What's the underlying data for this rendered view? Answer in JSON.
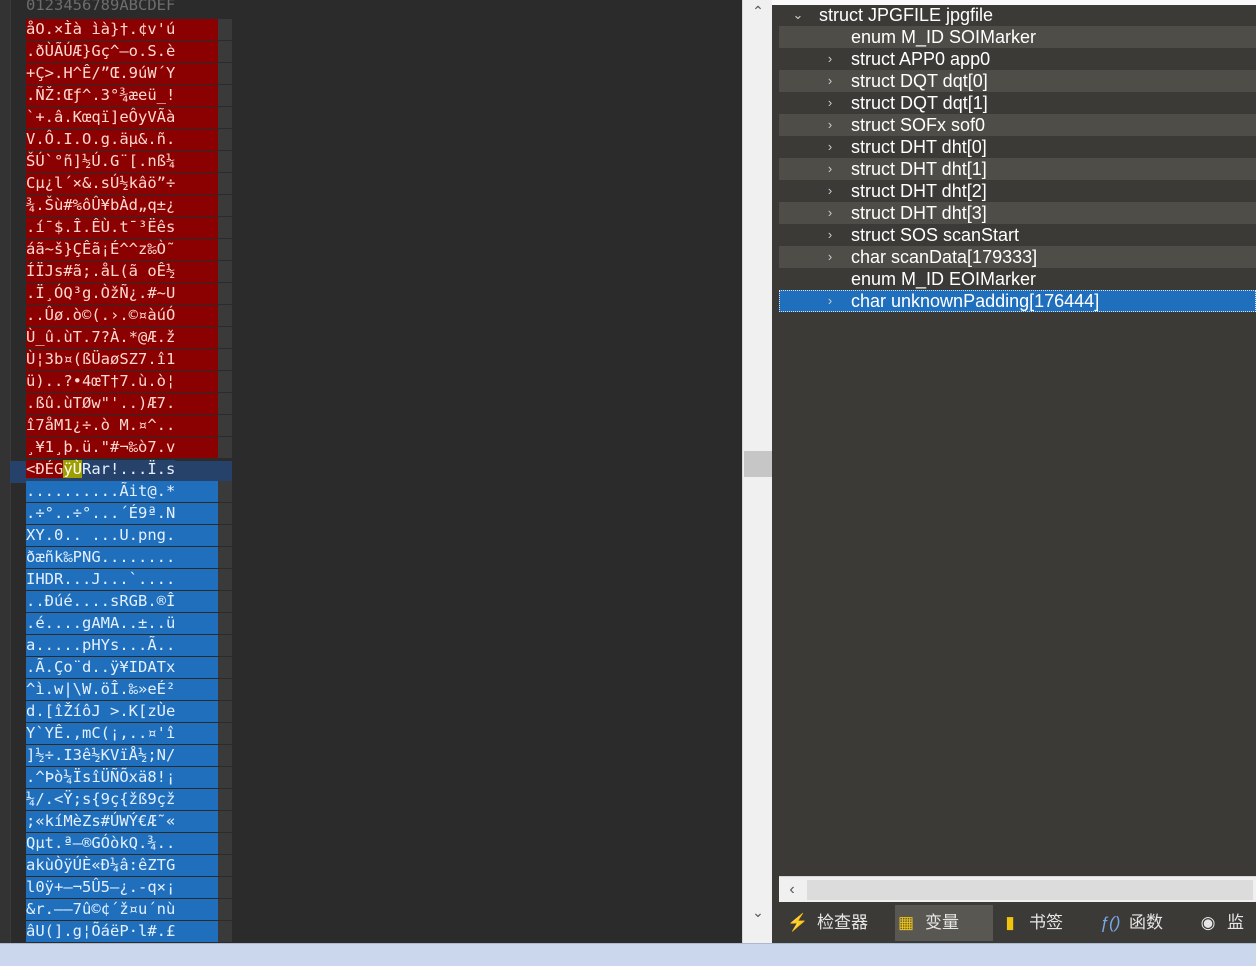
{
  "hex_view": {
    "ruler": "0123456789ABCDEF",
    "lines": [
      {
        "text": "åO.×Ìà ìà}†.¢v'ú",
        "style": "red"
      },
      {
        "text": ".ðÙÃÚÆ}Gç^–o.S.è",
        "style": "red"
      },
      {
        "text": "+Ç>.H^Ê/”Œ.9úW´Y",
        "style": "red"
      },
      {
        "text": ".ÑŽ:Œƒ^.3°¾æeü_!",
        "style": "red"
      },
      {
        "text": "`+.â.Kœqï]eÔyVÃà",
        "style": "red"
      },
      {
        "text": "V.Ô.I.O.g.äµ&.ñ.",
        "style": "red"
      },
      {
        "text": "ŠÚ`°ñ]½Ú.G¨[.nß¼",
        "style": "red"
      },
      {
        "text": "Cµ¿l´×&.sÚ½kâö”÷",
        "style": "red"
      },
      {
        "text": "¾.Šù#%ôÛ¥bÀd„q±¿",
        "style": "red"
      },
      {
        "text": ".í¯$.Î.ÊÙ.t¯³Ëês",
        "style": "red"
      },
      {
        "text": "áã~š}ÇÊã¡É^^z‰Ò˜",
        "style": "red"
      },
      {
        "text": "ÍÏJs#ã;.åL(ã oÊ½",
        "style": "red"
      },
      {
        "text": ".Ï¸ÓQ³g.ÒžÑ¿.#~U",
        "style": "red"
      },
      {
        "text": "..Ûø.ò©(.›.©¤àúÓ",
        "style": "red"
      },
      {
        "text": "Ù_û.ùT.7?À.*@Æ.ž",
        "style": "red"
      },
      {
        "text": "Ù¦3b¤(ßÜaøSZ7.î1",
        "style": "red"
      },
      {
        "text": "ü)..?•4œT†7.ù.ò¦",
        "style": "red"
      },
      {
        "text": ".ßû.ùTØw\"'..)Æ7.",
        "style": "red"
      },
      {
        "text": "î7åM1¿÷.ò M.¤^..",
        "style": "red"
      },
      {
        "text": "¸¥1¸þ.ü.\"#¬‰ò7.v",
        "style": "red"
      },
      {
        "text": "<ÐÉGÿÙRar!...Ï.s",
        "style": "mixed"
      },
      {
        "text": "..........Ãit@.*",
        "style": "blue"
      },
      {
        "text": ".÷°..÷°...´É9ª.N",
        "style": "blue"
      },
      {
        "text": "XY.0.. ...U.png.",
        "style": "blue"
      },
      {
        "text": "ðæñk‰PNG........",
        "style": "blue"
      },
      {
        "text": "IHDR...J...`....",
        "style": "blue"
      },
      {
        "text": "..Ðúé....sRGB.®Î",
        "style": "blue"
      },
      {
        "text": ".é....gAMA..±..ü",
        "style": "blue"
      },
      {
        "text": "a.....pHYs...Ã..",
        "style": "blue"
      },
      {
        "text": ".Ã.Ço¨d..ÿ¥IDATx",
        "style": "blue"
      },
      {
        "text": "^ì.w|\\W.öÎ.‰»eÉ²",
        "style": "blue"
      },
      {
        "text": "d.[îŽíôJ >.K[zÙe",
        "style": "blue"
      },
      {
        "text": "Y`YÊ.,mC(¡,..¤'î",
        "style": "blue"
      },
      {
        "text": "]½÷.I3ê½KVïÅ½;N/",
        "style": "blue"
      },
      {
        "text": ".^Þò¼ÏsîÜÑÕxä8!¡",
        "style": "blue"
      },
      {
        "text": "¼/.<Ÿ;s{9ç{žß9çž",
        "style": "blue"
      },
      {
        "text": ";«kíMèZs#ÚWÝ€Æ˜«",
        "style": "blue"
      },
      {
        "text": "Qµt.ª—®GÓòkQ.¾..",
        "style": "blue"
      },
      {
        "text": "akùÒÿÚÈ«Ð¼â:êZTG",
        "style": "blue"
      },
      {
        "text": "l0ÿ+–¬5Û5–¿.-q×¡",
        "style": "blue"
      },
      {
        "text": "&r.——7û©¢´ž¤u´nù",
        "style": "blue"
      },
      {
        "text": "âU(].g¦ÕáëP·l#.£",
        "style": "blue"
      }
    ],
    "mixed_row": {
      "red_part": "<ÐÉG",
      "highlight_part": "ÿÙ",
      "blue_part": "Rar!...Ï.s"
    }
  },
  "template_tree": {
    "rows": [
      {
        "label": "struct JPGFILE jpgfile",
        "level": 0,
        "toggle": "expanded",
        "band": false,
        "selected": false
      },
      {
        "label": "enum M_ID SOIMarker",
        "level": 1,
        "toggle": "none",
        "band": true,
        "selected": false
      },
      {
        "label": "struct APP0 app0",
        "level": 1,
        "toggle": "collapsed",
        "band": false,
        "selected": false
      },
      {
        "label": "struct DQT dqt[0]",
        "level": 1,
        "toggle": "collapsed",
        "band": true,
        "selected": false
      },
      {
        "label": "struct DQT dqt[1]",
        "level": 1,
        "toggle": "collapsed",
        "band": false,
        "selected": false
      },
      {
        "label": "struct SOFx sof0",
        "level": 1,
        "toggle": "collapsed",
        "band": true,
        "selected": false
      },
      {
        "label": "struct DHT dht[0]",
        "level": 1,
        "toggle": "collapsed",
        "band": false,
        "selected": false
      },
      {
        "label": "struct DHT dht[1]",
        "level": 1,
        "toggle": "collapsed",
        "band": true,
        "selected": false
      },
      {
        "label": "struct DHT dht[2]",
        "level": 1,
        "toggle": "collapsed",
        "band": false,
        "selected": false
      },
      {
        "label": "struct DHT dht[3]",
        "level": 1,
        "toggle": "collapsed",
        "band": true,
        "selected": false
      },
      {
        "label": "struct SOS scanStart",
        "level": 1,
        "toggle": "collapsed",
        "band": false,
        "selected": false
      },
      {
        "label": "char scanData[179333]",
        "level": 1,
        "toggle": "collapsed",
        "band": true,
        "selected": false
      },
      {
        "label": "enum M_ID EOIMarker",
        "level": 1,
        "toggle": "none",
        "band": false,
        "selected": false
      },
      {
        "label": "char unknownPadding[176444]",
        "level": 1,
        "toggle": "collapsed",
        "band": false,
        "selected": true
      }
    ]
  },
  "bottom_tabs": [
    {
      "label": "检查器",
      "icon": "lightning-icon",
      "glyph": "⚡",
      "active": false
    },
    {
      "label": "变量",
      "icon": "variables-icon",
      "glyph": "▦",
      "active": true
    },
    {
      "label": "书签",
      "icon": "bookmark-icon",
      "glyph": "▮",
      "active": false
    },
    {
      "label": "函数",
      "icon": "function-icon",
      "glyph": "ƒ()",
      "active": false
    },
    {
      "label": "监",
      "icon": "eye-icon",
      "glyph": "◉",
      "active": false
    }
  ],
  "colors": {
    "pane_bg": "#2b2b2b",
    "tree_bg": "#3b3a36",
    "red_selection": "#8b0000",
    "blue_selection": "#1f6fbd",
    "highlight": "#9e9e00"
  }
}
